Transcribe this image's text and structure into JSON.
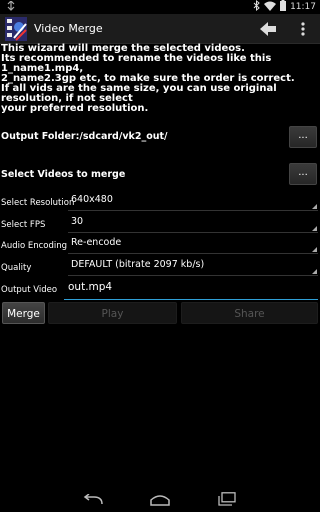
{
  "status_bar": {
    "time": "11:17"
  },
  "action_bar": {
    "title": "Video Merge"
  },
  "description": "This wizard will merge the selected videos.\n Its recommended to rename the videos like this 1_name1.mp4,\n2_name2.3gp etc, to make sure the order is correct.\n If all vids are the same size, you can use original resolution, if not select\nyour preferred resolution.",
  "output_folder": {
    "label": "Output Folder:/sdcard/vk2_out/",
    "button": "..."
  },
  "select_videos": {
    "label": "Select Videos to merge",
    "button": "..."
  },
  "form": {
    "resolution": {
      "label": "Select Resolution",
      "value": "640x480"
    },
    "fps": {
      "label": "Select FPS",
      "value": "30"
    },
    "audio": {
      "label": "Audio Encoding",
      "value": "Re-encode"
    },
    "quality": {
      "label": "Quality",
      "value": "DEFAULT (bitrate 2097 kb/s)"
    },
    "output_video": {
      "label": "Output Video",
      "value": "out.mp4"
    }
  },
  "buttons": {
    "merge": "Merge",
    "play": "Play",
    "share": "Share"
  },
  "colors": {
    "accent": "#2f9fd6",
    "actionbar": "#1c1c1c",
    "background": "#000000"
  }
}
